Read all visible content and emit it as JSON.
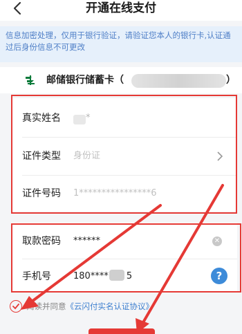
{
  "header": {
    "title": "开通在线支付"
  },
  "notice": {
    "text": "信息加密处理，仅用于银行验证，请验证您本人的银行卡,认证通过后身份信息不可更改"
  },
  "bank": {
    "name": "邮储银行储蓄卡",
    "open_paren": "（",
    "close_paren": "）"
  },
  "identity": {
    "name_label": "真实姓名",
    "name_value": "*",
    "id_type_label": "证件类型",
    "id_type_value": "身份证",
    "id_number_label": "证件号码",
    "id_number_value": "1****************6"
  },
  "account": {
    "password_label": "取款密码",
    "password_value": "******",
    "phone_label": "手机号",
    "phone_prefix": "180****",
    "phone_suffix": "5"
  },
  "agreement": {
    "prefix": "阅读并同意",
    "link": "《云闪付实名认证协议》"
  },
  "colors": {
    "accent": "#e53935",
    "link": "#3d7fcf",
    "help": "#3d8bd9",
    "notice_bg": "#e6f0fb"
  },
  "icons": {
    "back": "chevron-left-icon",
    "bank_logo": "postal-bank-logo",
    "chevron": "chevron-right-icon",
    "clear": "clear-icon",
    "help": "help-icon",
    "check": "check-icon"
  }
}
